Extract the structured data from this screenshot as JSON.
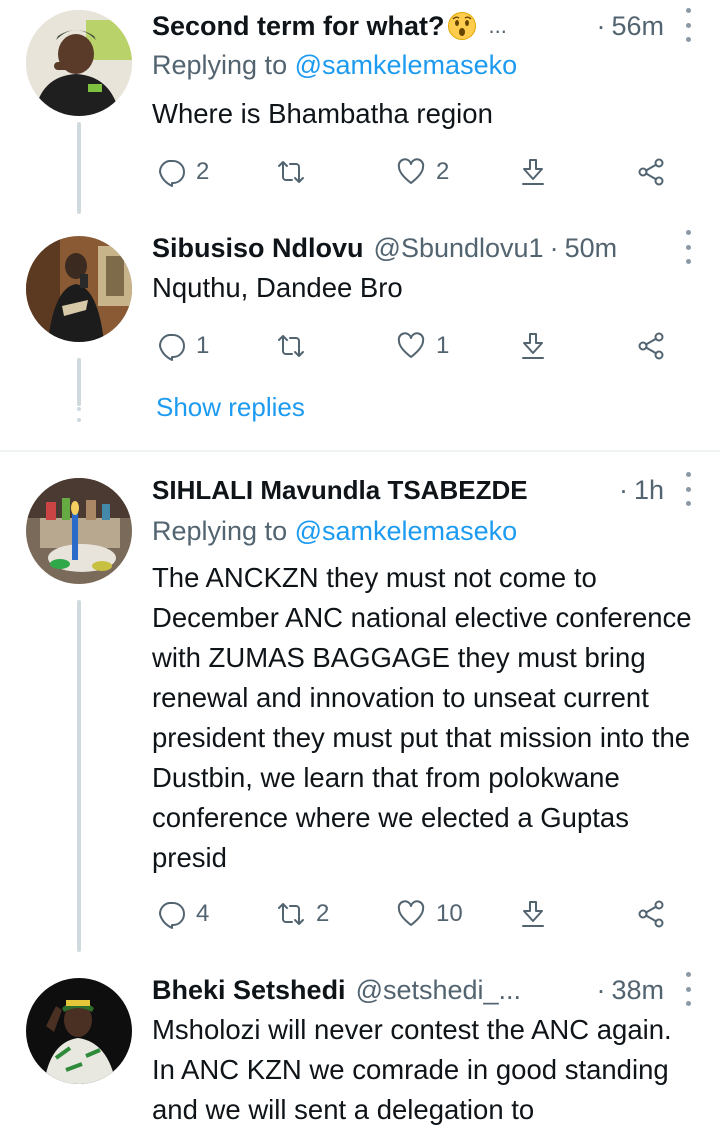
{
  "tweets": [
    {
      "name": "Second term for what?",
      "name_suffix": "...",
      "emoji": "astonished-face",
      "handle": "",
      "dot": "·",
      "time": "56m",
      "replying_prefix": "Replying to",
      "replying_to": "@samkelemaseko",
      "text": "Where is Bhambatha region",
      "replies": "2",
      "retweets": "",
      "likes": "2"
    },
    {
      "name": "Sibusiso Ndlovu",
      "handle": "@Sbundlovu1",
      "dot": "·",
      "time": "50m",
      "text": "Nquthu, Dandee Bro",
      "replies": "1",
      "retweets": "",
      "likes": "1"
    },
    {
      "name": "SIHLALI Mavundla TSABEZDE",
      "handle": "",
      "dot": "·",
      "time": "1h",
      "replying_prefix": "Replying to",
      "replying_to": "@samkelemaseko",
      "text": "The ANCKZN they must not come to December ANC national elective conference with ZUMAS BAGGAGE they must bring renewal and innovation to unseat current president they must put that mission into the Dustbin, we learn that from  polokwane  conference where we elected a Guptas presid",
      "replies": "4",
      "retweets": "2",
      "likes": "10"
    },
    {
      "name": "Bheki Setshedi",
      "handle": "@setshedi_...",
      "dot": "·",
      "time": "38m",
      "text": "Msholozi will never contest the ANC again. In ANC KZN we comrade in good standing and we will sent a delegation to"
    }
  ],
  "show_replies": "Show replies",
  "icons": {
    "reply": "reply-icon",
    "retweet": "retweet-icon",
    "like": "heart-icon",
    "download": "download-icon",
    "share": "share-icon",
    "more": "more-vertical-icon"
  },
  "colors": {
    "text": "#0f1419",
    "secondary": "#536471",
    "accent": "#1d9bf0",
    "line": "#cfd9de",
    "divider": "#eff3f4"
  }
}
